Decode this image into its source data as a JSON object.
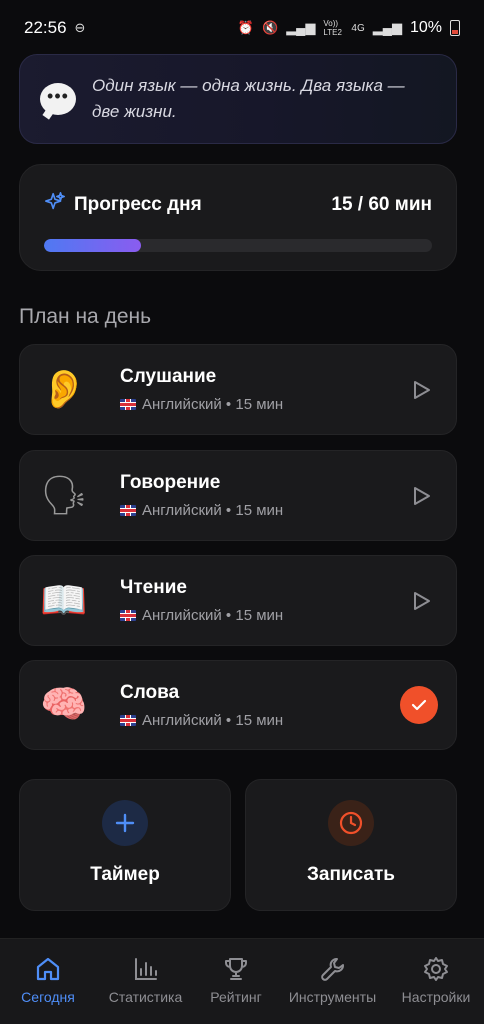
{
  "status_bar": {
    "time": "22:56",
    "network": "4G",
    "volte": "Vo)) LTE2",
    "battery": "10%"
  },
  "quote": {
    "text": "Один язык — одна жизнь. Два языка — две жизни."
  },
  "progress": {
    "title": "Прогресс дня",
    "value_text": "15 / 60 мин",
    "fraction": 0.25
  },
  "plan": {
    "title": "План на день",
    "tasks": [
      {
        "name": "Слушание",
        "emoji": "👂",
        "meta": "Английский • 15 мин",
        "state": "play"
      },
      {
        "name": "Говорение",
        "emoji": "🗣",
        "meta": "Английский • 15 мин",
        "state": "play"
      },
      {
        "name": "Чтение",
        "emoji": "📖",
        "meta": "Английский • 15 мин",
        "state": "play"
      },
      {
        "name": "Слова",
        "emoji": "🧠",
        "meta": "Английский • 15 мин",
        "state": "done"
      }
    ]
  },
  "actions": {
    "timer": {
      "label": "Таймер",
      "icon": "plus-icon"
    },
    "record": {
      "label": "Записать",
      "icon": "clock-icon"
    }
  },
  "nav": {
    "items": [
      {
        "label": "Сегодня",
        "icon": "home-icon",
        "active": true
      },
      {
        "label": "Статистика",
        "icon": "chart-icon",
        "active": false
      },
      {
        "label": "Рейтинг",
        "icon": "trophy-icon",
        "active": false
      },
      {
        "label": "Инструменты",
        "icon": "wrench-icon",
        "active": false
      },
      {
        "label": "Настройки",
        "icon": "gear-icon",
        "active": false
      }
    ]
  },
  "colors": {
    "accent_blue": "#4f8ef7",
    "accent_orange": "#f0502a",
    "progress_start": "#4f79f2",
    "progress_end": "#8a5cf0"
  }
}
